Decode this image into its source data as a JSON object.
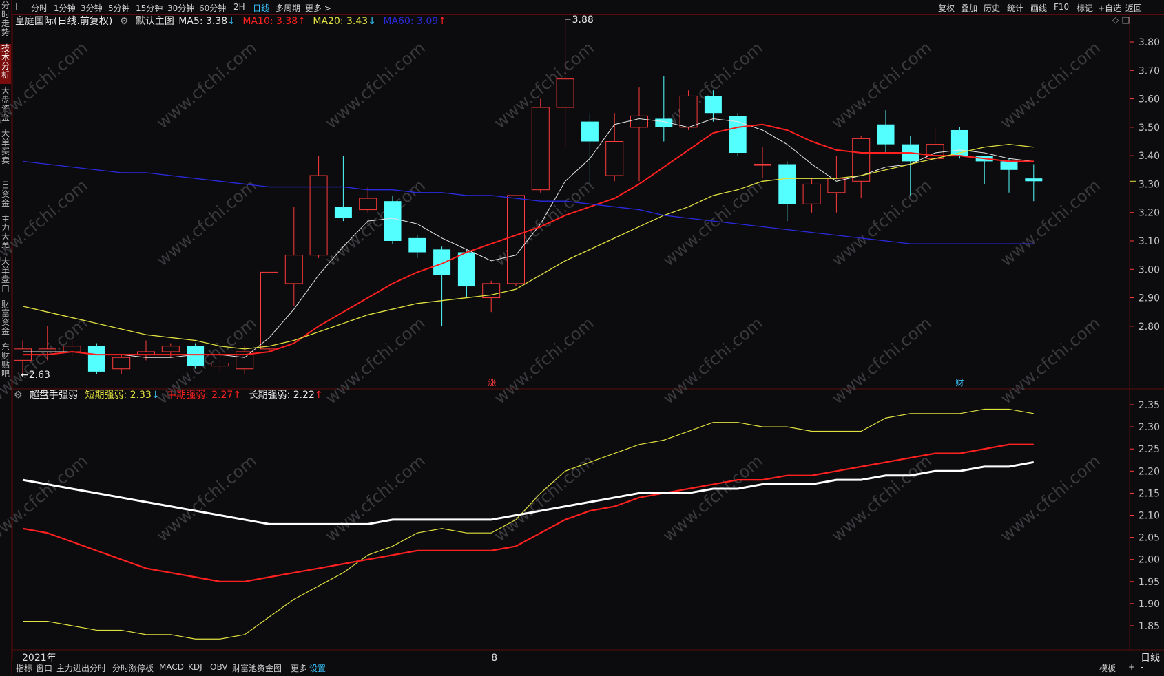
{
  "left_nav": [
    "分时走势",
    "技术分析",
    "大盘资金",
    "大单买卖",
    "一日资金",
    "主力大单",
    "大单盘口",
    "财富资金",
    "东财贴吧"
  ],
  "left_nav_active": 1,
  "top_left_tabs": [
    "分时",
    "1分钟",
    "3分钟",
    "5分钟",
    "15分钟",
    "30分钟",
    "60分钟",
    "2H",
    "日线",
    "多周期",
    "更多 >"
  ],
  "top_left_active": 8,
  "top_right_tabs": [
    "复权",
    "叠加",
    "历史",
    "统计",
    "画线",
    "F10",
    "标记",
    "+自选",
    "返回"
  ],
  "main_legend": {
    "title": "皇庭国际(日线.前复权)",
    "template": "默认主图",
    "ma5": "MA5: 3.38",
    "ma5_arrow": "↓",
    "ma10": "MA10: 3.38",
    "ma10_arrow": "↑",
    "ma20": "MA20: 3.43",
    "ma20_arrow": "↓",
    "ma60": "MA60: 3.09",
    "ma60_arrow": "↑"
  },
  "sub_legend": {
    "name": "超盘手强弱",
    "short": "短期强弱: 2.33",
    "short_arrow": "↓",
    "mid": "中期强弱: 2.27",
    "mid_arrow": "↑",
    "long": "长期强弱: 2.22",
    "long_arrow": "↑"
  },
  "markers": {
    "zhang": "涨",
    "cai": "财"
  },
  "x_labels": {
    "year": "2021年",
    "month": "8",
    "period": "日线"
  },
  "watermark": "www.cfchi.com",
  "bottom_tabs": [
    "指标",
    "窗口",
    "主力进出分时",
    "分时涨停板",
    "MACD",
    "KDJ",
    "OBV",
    "财富池资金图",
    "更多",
    "设置"
  ],
  "bottom_active": 9,
  "bottom_right": [
    "模板",
    "+",
    "-"
  ],
  "colors": {
    "up": "#ff3b3b",
    "down": "#54ffff",
    "ma5": "#e6e6e6",
    "ma10": "#ff2020",
    "ma20": "#e0e040",
    "ma60": "#2a2ae0",
    "short": "#e0e040",
    "mid": "#ff2020",
    "long": "#ffffff",
    "grid_border": "#5a0c0c"
  },
  "chart_data": [
    {
      "type": "candlestick",
      "title": "皇庭国际(日线.前复权)",
      "y_ticks": [
        3.8,
        3.7,
        3.6,
        3.5,
        3.4,
        3.3,
        3.2,
        3.1,
        3.0,
        2.9,
        2.8
      ],
      "ylim": [
        2.55,
        3.92
      ],
      "high_label": "3.88",
      "low_label": "←2.63",
      "candles": [
        {
          "o": 2.68,
          "c": 2.72,
          "h": 2.75,
          "l": 2.63
        },
        {
          "o": 2.71,
          "c": 2.72,
          "h": 2.8,
          "l": 2.68
        },
        {
          "o": 2.71,
          "c": 2.73,
          "h": 2.75,
          "l": 2.69
        },
        {
          "o": 2.73,
          "c": 2.64,
          "h": 2.74,
          "l": 2.63
        },
        {
          "o": 2.65,
          "c": 2.69,
          "h": 2.7,
          "l": 2.63
        },
        {
          "o": 2.7,
          "c": 2.71,
          "h": 2.75,
          "l": 2.68
        },
        {
          "o": 2.71,
          "c": 2.73,
          "h": 2.74,
          "l": 2.69
        },
        {
          "o": 2.73,
          "c": 2.66,
          "h": 2.74,
          "l": 2.65
        },
        {
          "o": 2.66,
          "c": 2.67,
          "h": 2.68,
          "l": 2.64
        },
        {
          "o": 2.65,
          "c": 2.71,
          "h": 2.73,
          "l": 2.63
        },
        {
          "o": 2.72,
          "c": 2.99,
          "h": 2.99,
          "l": 2.71
        },
        {
          "o": 2.95,
          "c": 3.05,
          "h": 3.22,
          "l": 2.87
        },
        {
          "o": 3.05,
          "c": 3.33,
          "h": 3.4,
          "l": 3.04
        },
        {
          "o": 3.22,
          "c": 3.18,
          "h": 3.4,
          "l": 3.17
        },
        {
          "o": 3.21,
          "c": 3.25,
          "h": 3.29,
          "l": 3.2
        },
        {
          "o": 3.24,
          "c": 3.1,
          "h": 3.26,
          "l": 3.09
        },
        {
          "o": 3.11,
          "c": 3.06,
          "h": 3.12,
          "l": 3.04
        },
        {
          "o": 3.07,
          "c": 2.98,
          "h": 3.08,
          "l": 2.8
        },
        {
          "o": 3.06,
          "c": 2.94,
          "h": 3.07,
          "l": 2.9
        },
        {
          "o": 2.9,
          "c": 2.95,
          "h": 2.96,
          "l": 2.85
        },
        {
          "o": 2.95,
          "c": 3.26,
          "h": 3.26,
          "l": 2.94
        },
        {
          "o": 3.28,
          "c": 3.57,
          "h": 3.6,
          "l": 3.27
        },
        {
          "o": 3.57,
          "c": 3.67,
          "h": 3.88,
          "l": 3.43
        },
        {
          "o": 3.52,
          "c": 3.45,
          "h": 3.55,
          "l": 3.3
        },
        {
          "o": 3.33,
          "c": 3.45,
          "h": 3.55,
          "l": 3.31
        },
        {
          "o": 3.5,
          "c": 3.54,
          "h": 3.64,
          "l": 3.31
        },
        {
          "o": 3.53,
          "c": 3.5,
          "h": 3.68,
          "l": 3.45
        },
        {
          "o": 3.5,
          "c": 3.61,
          "h": 3.63,
          "l": 3.49
        },
        {
          "o": 3.61,
          "c": 3.55,
          "h": 3.63,
          "l": 3.52
        },
        {
          "o": 3.54,
          "c": 3.41,
          "h": 3.55,
          "l": 3.4
        },
        {
          "o": 3.37,
          "c": 3.37,
          "h": 3.43,
          "l": 3.32
        },
        {
          "o": 3.37,
          "c": 3.23,
          "h": 3.38,
          "l": 3.17
        },
        {
          "o": 3.23,
          "c": 3.3,
          "h": 3.32,
          "l": 3.2
        },
        {
          "o": 3.27,
          "c": 3.32,
          "h": 3.4,
          "l": 3.2
        },
        {
          "o": 3.31,
          "c": 3.46,
          "h": 3.47,
          "l": 3.25
        },
        {
          "o": 3.51,
          "c": 3.44,
          "h": 3.56,
          "l": 3.41
        },
        {
          "o": 3.44,
          "c": 3.38,
          "h": 3.47,
          "l": 3.26
        },
        {
          "o": 3.39,
          "c": 3.44,
          "h": 3.5,
          "l": 3.38
        },
        {
          "o": 3.49,
          "c": 3.4,
          "h": 3.5,
          "l": 3.39
        },
        {
          "o": 3.4,
          "c": 3.38,
          "h": 3.4,
          "l": 3.3
        },
        {
          "o": 3.38,
          "c": 3.35,
          "h": 3.39,
          "l": 3.27
        },
        {
          "o": 3.32,
          "c": 3.31,
          "h": 3.37,
          "l": 3.24
        }
      ],
      "series": [
        {
          "name": "MA5",
          "values": [
            2.71,
            2.71,
            2.71,
            2.7,
            2.7,
            2.69,
            2.69,
            2.7,
            2.7,
            2.69,
            2.76,
            2.86,
            2.98,
            3.08,
            3.17,
            3.18,
            3.16,
            3.11,
            3.07,
            3.03,
            3.05,
            3.16,
            3.31,
            3.39,
            3.51,
            3.53,
            3.52,
            3.5,
            3.53,
            3.52,
            3.49,
            3.44,
            3.37,
            3.31,
            3.33,
            3.36,
            3.37,
            3.41,
            3.42,
            3.41,
            3.39,
            3.38
          ]
        },
        {
          "name": "MA10",
          "values": [
            2.7,
            2.7,
            2.71,
            2.7,
            2.7,
            2.7,
            2.7,
            2.7,
            2.7,
            2.7,
            2.71,
            2.74,
            2.8,
            2.85,
            2.9,
            2.95,
            2.99,
            3.02,
            3.06,
            3.09,
            3.12,
            3.15,
            3.19,
            3.22,
            3.25,
            3.3,
            3.36,
            3.42,
            3.48,
            3.5,
            3.51,
            3.49,
            3.45,
            3.42,
            3.41,
            3.41,
            3.41,
            3.4,
            3.4,
            3.39,
            3.38,
            3.38
          ]
        },
        {
          "name": "MA20",
          "values": [
            2.87,
            2.85,
            2.83,
            2.81,
            2.79,
            2.77,
            2.76,
            2.75,
            2.73,
            2.72,
            2.73,
            2.75,
            2.78,
            2.81,
            2.84,
            2.86,
            2.88,
            2.89,
            2.9,
            2.91,
            2.93,
            2.98,
            3.03,
            3.07,
            3.11,
            3.15,
            3.19,
            3.22,
            3.26,
            3.28,
            3.31,
            3.32,
            3.32,
            3.32,
            3.33,
            3.35,
            3.37,
            3.39,
            3.41,
            3.43,
            3.44,
            3.43
          ]
        },
        {
          "name": "MA60",
          "values": [
            3.38,
            3.37,
            3.36,
            3.35,
            3.34,
            3.34,
            3.33,
            3.32,
            3.31,
            3.3,
            3.29,
            3.29,
            3.29,
            3.29,
            3.28,
            3.28,
            3.27,
            3.27,
            3.26,
            3.26,
            3.25,
            3.24,
            3.24,
            3.23,
            3.22,
            3.21,
            3.19,
            3.18,
            3.17,
            3.16,
            3.15,
            3.14,
            3.13,
            3.12,
            3.11,
            3.1,
            3.09,
            3.09,
            3.09,
            3.09,
            3.09,
            3.09
          ]
        }
      ]
    },
    {
      "type": "line",
      "title": "超盘手强弱",
      "y_ticks": [
        2.35,
        2.3,
        2.25,
        2.2,
        2.15,
        2.1,
        2.05,
        2.0,
        1.95,
        1.9,
        1.85
      ],
      "ylim": [
        1.82,
        2.37
      ],
      "series": [
        {
          "name": "短期强弱",
          "values": [
            1.86,
            1.86,
            1.85,
            1.84,
            1.84,
            1.83,
            1.83,
            1.82,
            1.82,
            1.83,
            1.87,
            1.91,
            1.94,
            1.97,
            2.01,
            2.03,
            2.06,
            2.07,
            2.06,
            2.06,
            2.09,
            2.15,
            2.2,
            2.22,
            2.24,
            2.26,
            2.27,
            2.29,
            2.31,
            2.31,
            2.3,
            2.3,
            2.29,
            2.29,
            2.29,
            2.32,
            2.33,
            2.33,
            2.33,
            2.34,
            2.34,
            2.33
          ]
        },
        {
          "name": "中期强弱",
          "values": [
            2.07,
            2.06,
            2.04,
            2.02,
            2.0,
            1.98,
            1.97,
            1.96,
            1.95,
            1.95,
            1.96,
            1.97,
            1.98,
            1.99,
            2.0,
            2.01,
            2.02,
            2.02,
            2.02,
            2.02,
            2.03,
            2.06,
            2.09,
            2.11,
            2.12,
            2.14,
            2.15,
            2.16,
            2.17,
            2.18,
            2.18,
            2.19,
            2.19,
            2.2,
            2.21,
            2.22,
            2.23,
            2.24,
            2.24,
            2.25,
            2.26,
            2.26
          ]
        },
        {
          "name": "长期强弱",
          "values": [
            2.18,
            2.17,
            2.16,
            2.15,
            2.14,
            2.13,
            2.12,
            2.11,
            2.1,
            2.09,
            2.08,
            2.08,
            2.08,
            2.08,
            2.08,
            2.09,
            2.09,
            2.09,
            2.09,
            2.09,
            2.1,
            2.11,
            2.12,
            2.13,
            2.14,
            2.15,
            2.15,
            2.15,
            2.16,
            2.16,
            2.17,
            2.17,
            2.17,
            2.18,
            2.18,
            2.19,
            2.19,
            2.2,
            2.2,
            2.21,
            2.21,
            2.22
          ]
        }
      ]
    }
  ]
}
